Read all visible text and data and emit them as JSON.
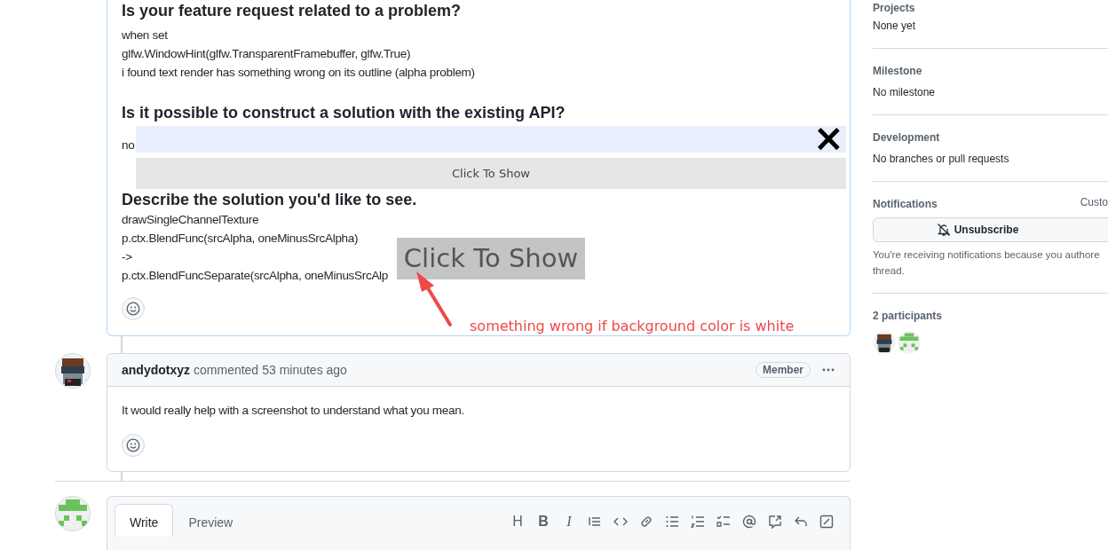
{
  "issue_body": {
    "sections": [
      {
        "heading": "Is your feature request related to a problem?",
        "lines": [
          "when set",
          "glfw.WindowHint(glfw.TransparentFramebuffer, glfw.True)",
          "i found text render has something wrong on its outline (alpha problem)"
        ]
      },
      {
        "heading": "Is it possible to construct a solution with the existing API?",
        "lines": [
          "no"
        ]
      },
      {
        "heading": "Describe the solution you'd like to see.",
        "lines": [
          "drawSingleChannelTexture",
          "p.ctx.BlendFunc(srcAlpha, oneMinusSrcAlpha)",
          "->",
          "p.ctx.BlendFuncSeparate(srcAlpha, oneMinusSrcAlp"
        ]
      }
    ]
  },
  "comments": [
    {
      "author": "andydotxyz",
      "action": "commented",
      "time": "53 minutes ago",
      "badge": "Member",
      "body": "It would really help with a screenshot to understand what you mean."
    }
  ],
  "editor": {
    "tabs": [
      {
        "label": "Write",
        "selected": true
      },
      {
        "label": "Preview",
        "selected": false
      }
    ],
    "toolbar_glyphs": [
      "H",
      "B",
      "I"
    ]
  },
  "sidebar": {
    "sections": [
      {
        "title": "Projects",
        "value": "None yet"
      },
      {
        "title": "Milestone",
        "value": "No milestone"
      },
      {
        "title": "Development",
        "value": "No branches or pull requests"
      }
    ],
    "notifications": {
      "title": "Notifications",
      "action": "Custo",
      "button": "Unsubscribe",
      "reason_lines": [
        "You're receiving notifications because you authore",
        "thread."
      ]
    },
    "participants": {
      "title": "2 participants"
    }
  },
  "overlays": {
    "close_bar": {
      "close": "×"
    },
    "show_bar": {
      "label": "Click To Show"
    },
    "show_label": {
      "label": "Click To Show"
    },
    "annotation": {
      "text": "something wrong if background color is white"
    }
  }
}
